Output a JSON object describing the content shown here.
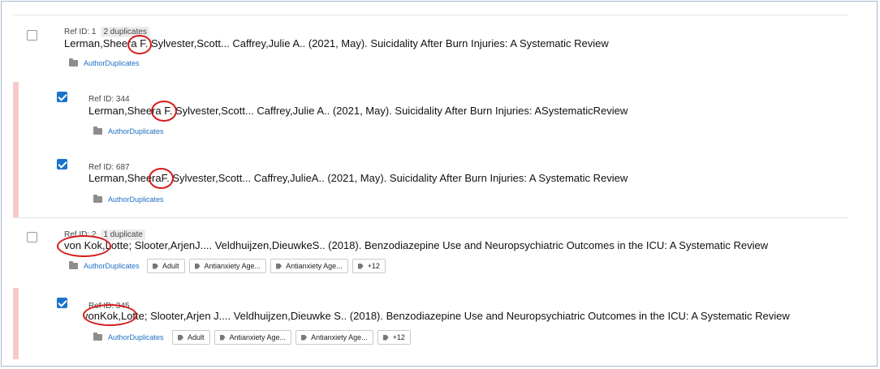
{
  "records": [
    {
      "ref": "Ref ID: 1",
      "badge": "2 duplicates",
      "citation": "Lerman,Sheera F. Sylvester,Scott... Caffrey,Julie A.. (2021, May). Suicidality After Burn Injuries: A Systematic Review",
      "folder": "AuthorDuplicates",
      "checked": false,
      "tags": []
    },
    {
      "ref": "Ref ID: 344",
      "citation": "Lerman,Sheera F. Sylvester,Scott... Caffrey,Julie A.. (2021, May). Suicidality After Burn Injuries: ASystematicReview",
      "folder": "AuthorDuplicates",
      "checked": true,
      "tags": []
    },
    {
      "ref": "Ref ID: 687",
      "citation": "Lerman,SheeraF. Sylvester,Scott... Caffrey,JulieA.. (2021, May). Suicidality After Burn Injuries: A Systematic Review",
      "folder": "AuthorDuplicates",
      "checked": true,
      "tags": []
    },
    {
      "ref": "Ref ID: 2",
      "badge": "1 duplicate",
      "citation": "von Kok,Lotte; Slooter,ArjenJ.... Veldhuijzen,DieuwkeS.. (2018). Benzodiazepine Use and Neuropsychiatric Outcomes in the ICU: A Systematic Review",
      "folder": "AuthorDuplicates",
      "checked": false,
      "tags": [
        "Adult",
        "Antianxiety Age...",
        "Antianxiety Age...",
        "+12"
      ]
    },
    {
      "ref": "Ref ID: 345",
      "citation": "vonKok,Lotte; Slooter,Arjen J.... Veldhuijzen,Dieuwke S.. (2018). Benzodiazepine Use and Neuropsychiatric Outcomes in the ICU: A Systematic Review",
      "folder": "AuthorDuplicates",
      "checked": true,
      "tags": [
        "Adult",
        "Antianxiety Age...",
        "Antianxiety Age...",
        "+12"
      ]
    }
  ],
  "colors": {
    "annotation_red": "#d61a1a",
    "duplicate_bar": "#f7c9c9",
    "checkbox_blue": "#1a73c9",
    "folder_link": "#1d6fc4"
  },
  "icons": [
    "folder-icon",
    "tag-icon",
    "checkbox-icon"
  ]
}
